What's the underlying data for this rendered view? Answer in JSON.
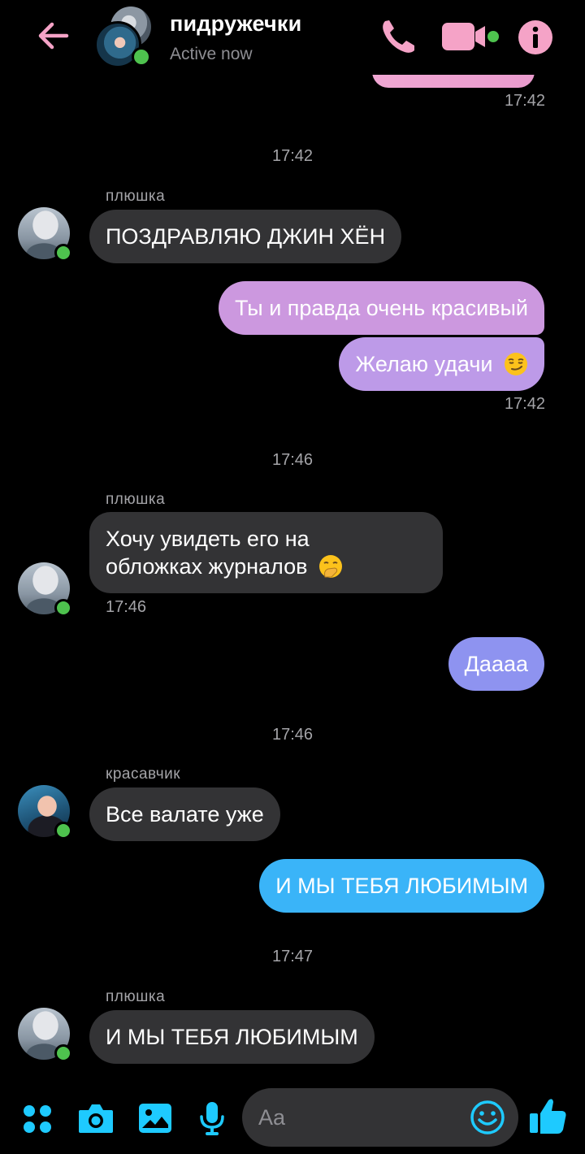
{
  "header": {
    "title": "пидружечки",
    "status": "Active now",
    "accent_color": "#f5a3c7"
  },
  "composer": {
    "placeholder": "Aa",
    "accent_color": "#1ecaff"
  },
  "messages": {
    "prev_time": "17:42",
    "group1": {
      "time": "17:42",
      "sender": "плюшка",
      "text": "ПОЗДРАВЛЯЮ ДЖИН ХЁН"
    },
    "out1": {
      "line1": "Ты и правда очень красивый",
      "line2": "Желаю удачи",
      "emoji": "smirking-face",
      "time": "17:42"
    },
    "group2": {
      "time": "17:46",
      "sender": "плюшка",
      "line1": "Хочу увидеть его на",
      "line2": "обложках журналов",
      "emoji": "face-with-hand-over-mouth",
      "msg_time": "17:46"
    },
    "out2": {
      "text": "Даааа"
    },
    "group3": {
      "time": "17:46",
      "sender": "красавчик",
      "text": "Все валате уже"
    },
    "out3": {
      "text": "И МЫ ТЕБЯ ЛЮБИМЫМ"
    },
    "group4": {
      "time": "17:47",
      "sender": "плюшка",
      "text": "И МЫ ТЕБЯ ЛЮБИМЫМ"
    }
  }
}
